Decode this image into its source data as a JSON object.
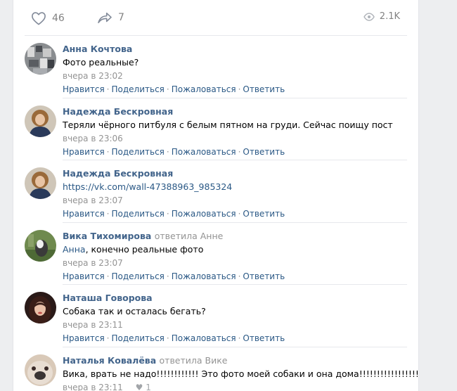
{
  "post_actions": {
    "likes": "46",
    "shares": "7",
    "views": "2.1K"
  },
  "comment_links": {
    "like": "Нравится",
    "share": "Поделиться",
    "report": "Пожаловаться",
    "reply": "Ответить"
  },
  "comments": [
    {
      "author": "Анна Кочтова",
      "reply_to": "",
      "text": "Фото реальные?",
      "time": "вчера в 23:02"
    },
    {
      "author": "Надежда Бескровная",
      "reply_to": "",
      "text": "Теряли чёрного питбуля с белым пятном на груди. Сейчас поищу пост",
      "time": "вчера в 23:06"
    },
    {
      "author": "Надежда Бескровная",
      "reply_to": "",
      "link": "https://vk.com/wall-47388963_985324",
      "time": "вчера в 23:07"
    },
    {
      "author": "Вика Тихомирова",
      "reply_to": "ответила Анне",
      "mention": "Анна",
      "text": ", конечно реальные фото",
      "time": "вчера в 23:07"
    },
    {
      "author": "Наташа Говорова",
      "reply_to": "",
      "text": "Собака так и осталась бегать?",
      "time": "вчера в 23:11"
    },
    {
      "author": "Наталья Ковалёва",
      "reply_to": "ответила Вике",
      "text": "Вика, врать не надо!!!!!!!!!!!! Это фото моей собаки и она дома!!!!!!!!!!!!!!!!!!!",
      "time": "вчера в 23:11",
      "likes": "1"
    }
  ]
}
